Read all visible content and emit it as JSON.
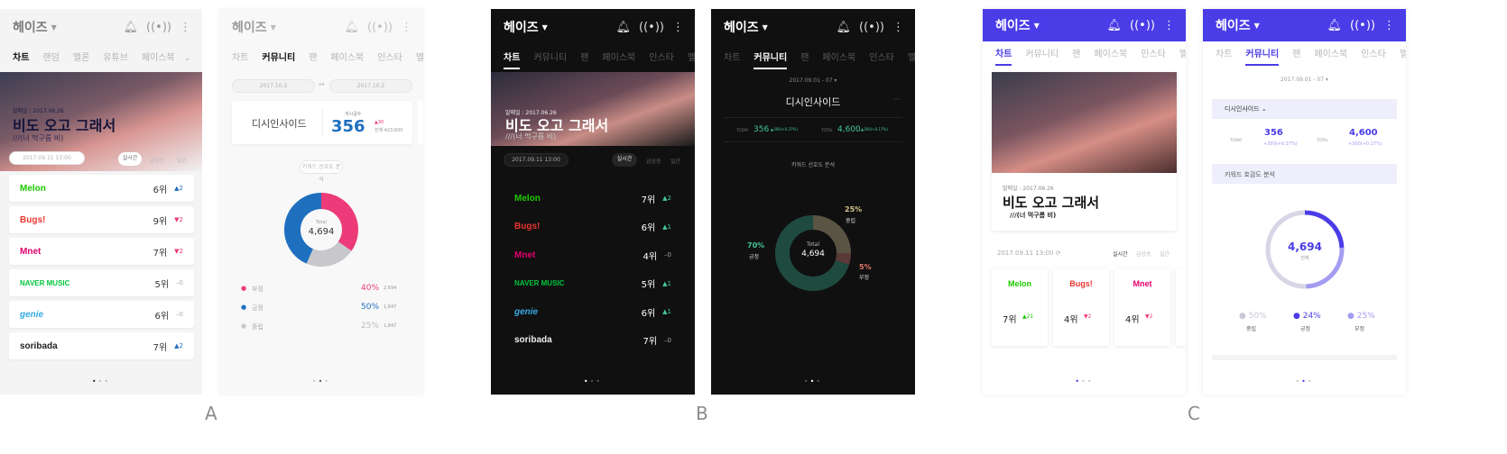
{
  "app": {
    "title": "헤이즈"
  },
  "chart_tabs": [
    "차트",
    "랜덤",
    "멜론",
    "유튜브",
    "페이스북"
  ],
  "community_tabs": [
    "차트",
    "커뮤니티",
    "팬",
    "페이스북",
    "인스타",
    "멜론"
  ],
  "song": {
    "release": "발매일 : 2017.06.26",
    "title": "비도 오고 그래서",
    "subtitle": "///(너 먹구름 비)"
  },
  "timestamp": "2017.09.11 13:00",
  "modes": [
    "실시간",
    "급상승",
    "일간"
  ],
  "chart_rows": {
    "A": [
      {
        "brand": "Melon",
        "rank": "6위",
        "delta": "2",
        "dir": "up"
      },
      {
        "brand": "Bugs!",
        "rank": "9위",
        "delta": "2",
        "dir": "down"
      },
      {
        "brand": "Mnet",
        "rank": "7위",
        "delta": "2",
        "dir": "down"
      },
      {
        "brand": "NAVER MUSIC",
        "rank": "5위",
        "delta": "0",
        "dir": "none"
      },
      {
        "brand": "genie",
        "rank": "6위",
        "delta": "0",
        "dir": "none"
      },
      {
        "brand": "soribada",
        "rank": "7위",
        "delta": "2",
        "dir": "up"
      }
    ],
    "B": [
      {
        "brand": "Melon",
        "rank": "7위",
        "delta": "2",
        "dir": "up"
      },
      {
        "brand": "Bugs!",
        "rank": "6위",
        "delta": "1",
        "dir": "up"
      },
      {
        "brand": "Mnet",
        "rank": "4위",
        "delta": "0",
        "dir": "none"
      },
      {
        "brand": "NAVER MUSIC",
        "rank": "5위",
        "delta": "1",
        "dir": "up"
      },
      {
        "brand": "genie",
        "rank": "6위",
        "delta": "1",
        "dir": "up"
      },
      {
        "brand": "soribada",
        "rank": "7위",
        "delta": "0",
        "dir": "none"
      }
    ],
    "C": [
      {
        "brand": "Melon",
        "rank": "7위",
        "delta": "21",
        "dir": "up"
      },
      {
        "brand": "Bugs!",
        "rank": "4위",
        "delta": "2",
        "dir": "down"
      },
      {
        "brand": "Mnet",
        "rank": "4위",
        "delta": "2",
        "dir": "down"
      }
    ]
  },
  "community": {
    "date_from": "2017.10.2",
    "date_to": "2017.10.2",
    "range_arrow": "↔",
    "date_range": "2017.09.01 - 07",
    "site": "디시인사이드",
    "post_label": "게시글수",
    "post_count": "356",
    "post_delta": "30",
    "post_total": "전체 423,600",
    "today_label": "TODAY",
    "today_value": "356",
    "today_change": "300(+0.37%)",
    "total_label": "TOTAL",
    "total_value": "4,600",
    "total_change": "300(+0.17%)",
    "analysis_label": "키워드 선호도 분석",
    "analysis_label_c": "키워드 호감도 분석",
    "total_caption": "Total",
    "total_caption_c": "전체",
    "total": "4,694"
  },
  "sentiment": [
    {
      "name": "부정",
      "percent": 40,
      "count": "2,694",
      "color": "#ec3b78"
    },
    {
      "name": "긍정",
      "percent": 50,
      "count": "1,847",
      "color": "#1f6fbf"
    },
    {
      "name": "중립",
      "percent": 25,
      "count": "1,847",
      "color": "#c7c7cc"
    }
  ],
  "sentiment_b": [
    {
      "name": "긍정",
      "percent": 70,
      "color": "#43c59e"
    },
    {
      "name": "중립",
      "percent": 25,
      "color": "#d8c58a"
    },
    {
      "name": "부정",
      "percent": 5,
      "color": "#e07b6a"
    }
  ],
  "sentiment_c": [
    {
      "name": "중립",
      "percent": 50,
      "color": "#d6d6e6"
    },
    {
      "name": "긍정",
      "percent": 24,
      "color": "#4a3ce6"
    },
    {
      "name": "부정",
      "percent": 25,
      "color": "#a39cf2"
    }
  ],
  "sentiment_labels": {
    "b_left": "70%",
    "b_left_name": "긍정",
    "b_top": "25%",
    "b_top_name": "중립",
    "b_right": "5%",
    "b_right_name": "부정"
  },
  "variants": [
    "A",
    "B",
    "C"
  ],
  "colors": {
    "brand_blue": "#4a3ce6",
    "melon": "#1ec800",
    "bugs": "#e8362f",
    "mnet": "#e3006e",
    "naver": "#00c73c",
    "genie": "#36a9e1"
  }
}
